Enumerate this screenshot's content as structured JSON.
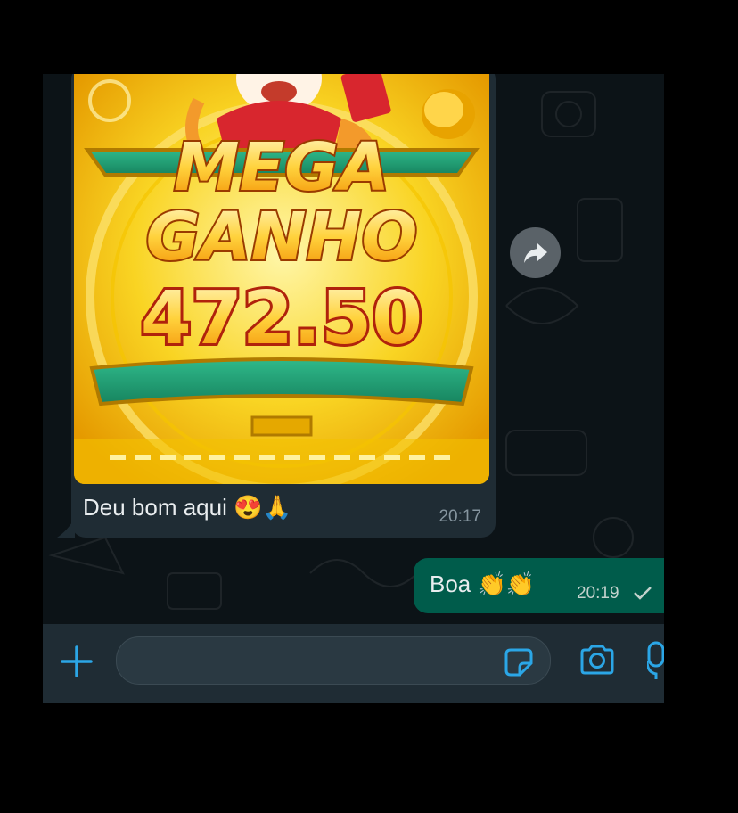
{
  "conversation": {
    "incoming": {
      "caption": "Deu bom aqui 😍🙏",
      "time": "20:17",
      "media": {
        "line1": "MEGA",
        "line2": "GANHO",
        "amount": "472.50"
      }
    },
    "outgoing": {
      "text": "Boa 👏👏",
      "time": "20:19"
    }
  },
  "composer": {
    "placeholder": ""
  },
  "colors": {
    "chat_bg": "#0c1317",
    "incoming_bubble": "#1f2c34",
    "outgoing_bubble": "#005c4b",
    "accent": "#2ba6e6"
  },
  "icons": [
    "forward-icon",
    "plus-icon",
    "sticker-icon",
    "camera-icon",
    "microphone-icon",
    "read-check-icon"
  ]
}
